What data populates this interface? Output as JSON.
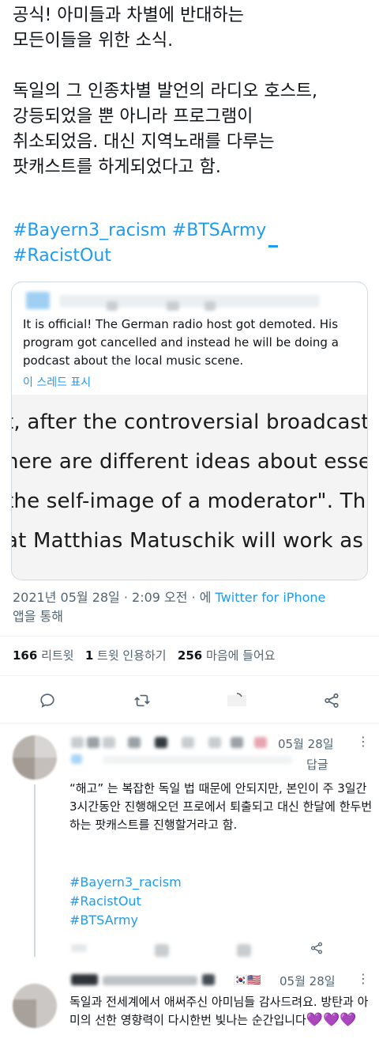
{
  "tweet": {
    "text": "공식! 아미들과 차별에 반대하는\n모든이들을 위한 소식.\n\n독일의 그 인종차별 발언의 라디오 호스트,\n강등되었을 뿐 아니라 프로그램이\n취소되었음. 대신 지역노래를 다루는\n팟캐스트를 하게되었다고 함.",
    "hashtags": [
      "#Bayern3_racism",
      "#BTSArmy",
      "#RacistOut"
    ]
  },
  "quote": {
    "body": "It is official! The German radio host got demoted. His program got cancelled and instead he will be doing a podcast about the local music scene.",
    "show_thread": "이 스레드 표시",
    "image_lines": [
      "t, after the controversial broadcast \"it",
      "here are different ideas about essenti",
      "the self-image of a moderator\". That \"",
      "at Matthias Matuschik will work as an"
    ]
  },
  "meta": {
    "date": "2021년 05월 28일 · 2:09 오전 · 에 ",
    "via": "Twitter for iPhone",
    "suffix": "앱을 통해"
  },
  "stats": {
    "retweets_count": "166",
    "retweets_label": "리트윗",
    "quotes_count": "1",
    "quotes_label": "트윗 인용하기",
    "likes_count": "256",
    "likes_label": "마음에 들어요"
  },
  "actions": {
    "icons": [
      "reply-icon",
      "retweet-icon",
      "like-icon",
      "share-icon"
    ]
  },
  "replies": [
    {
      "date": "05월 28일",
      "reply_label": "답글",
      "text": "“해고” 는 복잡한 독일 법 때문에 안되지만, 본인이 주 3일간 3시간동안 진행해오던 프로에서 퇴출되고 대신 한달에 한두번 하는 팟캐스트를 진행할거라고 함.",
      "hashtags": [
        "#Bayern3_racism",
        "#RacistOut",
        "#BTSArmy"
      ]
    },
    {
      "date": "05월 28일",
      "text": "독일과 전세계에서 애써주신 아미님들 감사드려요. 방탄과 아미의 선한 영향력이 다시한번 빛나는 순간입니다",
      "hearts": "💜💜💜"
    }
  ],
  "colors": {
    "accent": "#1d9bf0",
    "text": "#0f1419",
    "muted": "#536471",
    "border": "#cfd9de"
  }
}
